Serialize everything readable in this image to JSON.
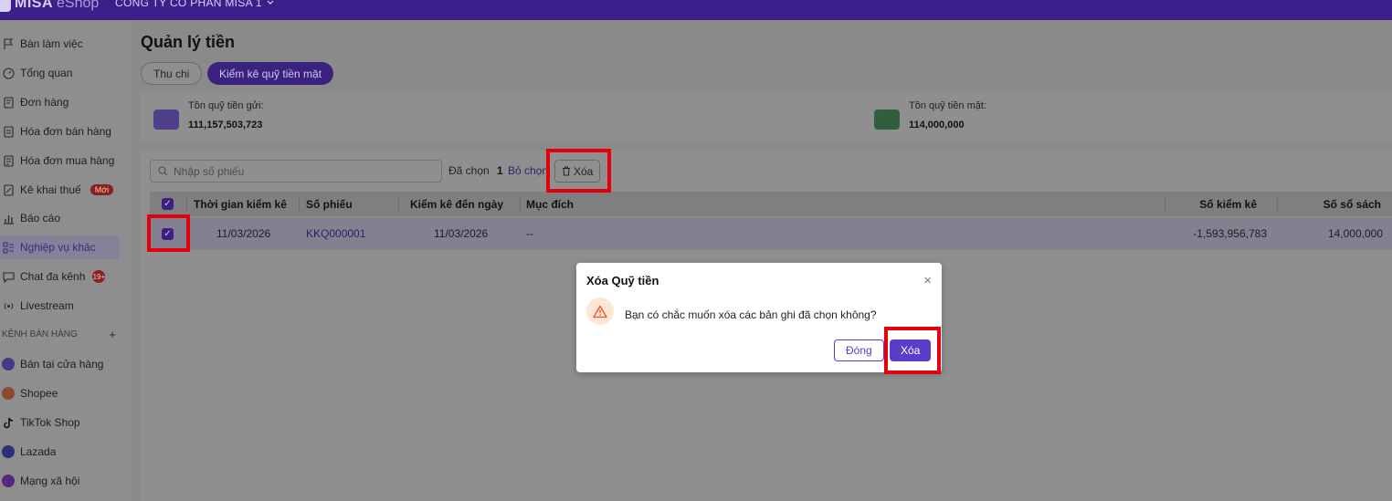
{
  "header": {
    "logo_text": "MISA",
    "logo_sub": "eShop",
    "company": "CÔNG TY CỔ PHẦN MISA 1"
  },
  "sidebar": {
    "items": [
      {
        "label": "Bàn làm việc",
        "icon": "flag-icon"
      },
      {
        "label": "Tổng quan",
        "icon": "gauge-icon"
      },
      {
        "label": "Đơn hàng",
        "icon": "order-icon"
      },
      {
        "label": "Hóa đơn bán hàng",
        "icon": "invoice-icon"
      },
      {
        "label": "Hóa đơn mua hàng",
        "icon": "purchase-invoice-icon"
      },
      {
        "label": "Kê khai thuế",
        "icon": "tax-icon",
        "badge": "Mới"
      },
      {
        "label": "Báo cáo",
        "icon": "chart-icon"
      },
      {
        "label": "Nghiệp vụ khác",
        "icon": "list-icon",
        "active": true
      },
      {
        "label": "Chat đa kênh",
        "icon": "chat-icon",
        "badge": "19+"
      },
      {
        "label": "Livestream",
        "icon": "broadcast-icon"
      }
    ],
    "section_title": "KÊNH BÁN HÀNG",
    "section_add": "+",
    "channels": [
      {
        "label": "Bán tại cửa hàng",
        "icon": "store-icon",
        "color": "#5b3dc8"
      },
      {
        "label": "Shopee",
        "icon": "shopee-icon",
        "color": "#e8542a"
      },
      {
        "label": "TikTok Shop",
        "icon": "tiktok-icon",
        "color": "#111111"
      },
      {
        "label": "Lazada",
        "icon": "lazada-icon",
        "color": "#2a3cc8"
      },
      {
        "label": "Mạng xã hội",
        "icon": "social-icon",
        "color": "#7a2ac8"
      }
    ]
  },
  "main": {
    "title": "Quản lý tiền",
    "tabs": [
      {
        "label": "Thu chi"
      },
      {
        "label": "Kiểm kê quỹ tiền mặt",
        "active": true
      }
    ],
    "summary": {
      "deposit_label": "Tồn quỹ tiền gửi:",
      "deposit_value": "111,157,503,723",
      "cash_label": "Tồn quỹ tiền mặt:",
      "cash_value": "114,000,000"
    },
    "toolbar": {
      "search_placeholder": "Nhập số phiếu",
      "selected_label": "Đã chọn",
      "selected_count": "1",
      "deselect_label": "Bỏ chọn",
      "delete_label": "Xóa"
    },
    "table": {
      "columns": [
        "Thời gian kiểm kê",
        "Số phiếu",
        "Kiểm kê đến ngày",
        "Mục đích",
        "Số kiểm kê",
        "Số sổ sách"
      ],
      "rows": [
        {
          "time": "11/03/2026",
          "number": "KKQ000001",
          "to_date": "11/03/2026",
          "purpose": "--",
          "counted": "-1,593,956,783",
          "book": "14,000,000",
          "checked": true
        }
      ]
    }
  },
  "dialog": {
    "title": "Xóa Quỹ tiền",
    "message": "Bạn có chắc muốn xóa các bản ghi đã chọn không?",
    "close_label": "Đóng",
    "confirm_label": "Xóa",
    "close_icon": "×"
  },
  "colors": {
    "brand": "#3d1f8c",
    "accent": "#5b3dc8",
    "highlight": "#e3000b",
    "warning": "#e8542a"
  }
}
